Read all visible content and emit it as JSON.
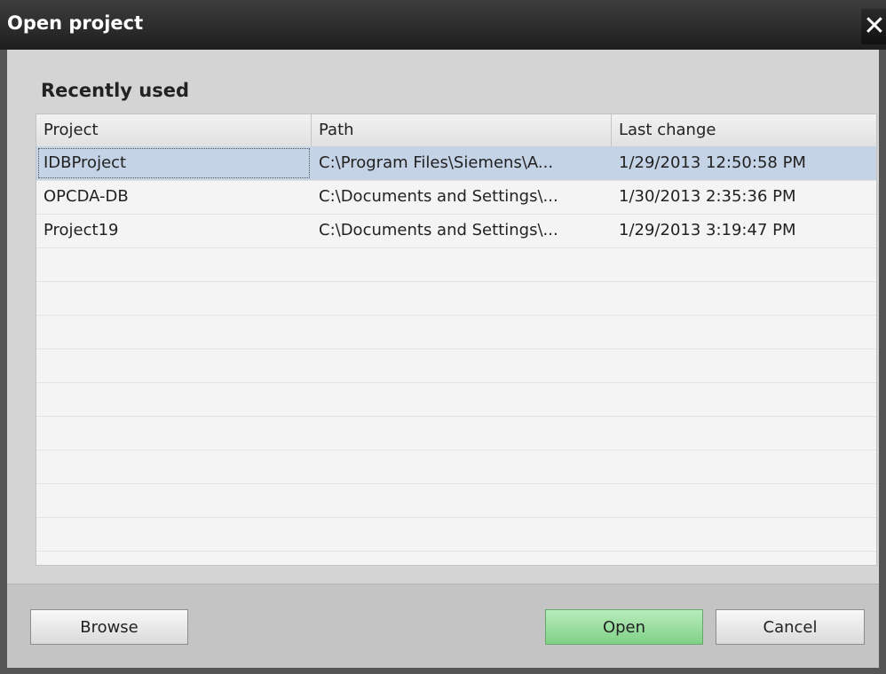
{
  "window": {
    "title": "Open project",
    "close_symbol": "✕"
  },
  "section": {
    "title": "Recently used"
  },
  "table": {
    "columns": [
      "Project",
      "Path",
      "Last change"
    ],
    "rows": [
      {
        "project": "IDBProject",
        "path": "C:\\Program Files\\Siemens\\A...",
        "last_change": "1/29/2013 12:50:58 PM",
        "selected": true
      },
      {
        "project": "OPCDA-DB",
        "path": "C:\\Documents and Settings\\...",
        "last_change": "1/30/2013 2:35:36 PM",
        "selected": false
      },
      {
        "project": "Project19",
        "path": "C:\\Documents and Settings\\...",
        "last_change": "1/29/2013 3:19:47 PM",
        "selected": false
      }
    ]
  },
  "buttons": {
    "browse": "Browse",
    "open": "Open",
    "cancel": "Cancel"
  }
}
